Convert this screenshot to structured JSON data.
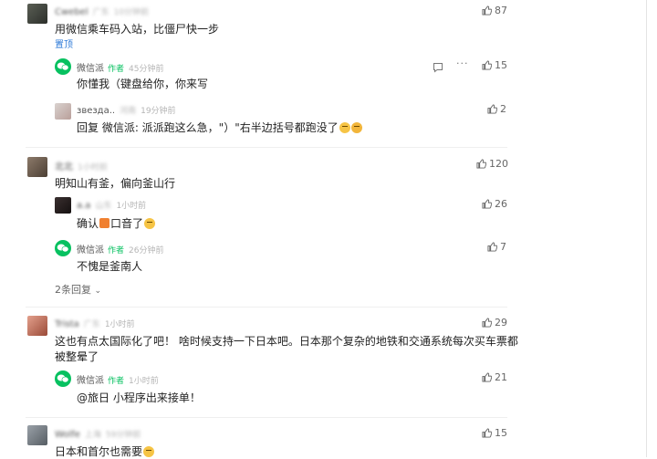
{
  "comments": [
    {
      "user": "Cwebel",
      "location": "广东",
      "time": "10分钟前",
      "text": "用微信乘车码入站，比僵尸快一步",
      "badge": "置顶",
      "likes": "87",
      "replies": [
        {
          "user": "微信派",
          "author_tag": "作者",
          "time": "45分钟前",
          "text": "你懂我（键盘给你，你来写",
          "likes": "15"
        },
        {
          "user": "звезда..",
          "location": "河南",
          "time": "19分钟前",
          "text": "回复 微信派: 派派跑这么急，\"）\"右半边括号都跑没了",
          "likes": "2"
        }
      ]
    },
    {
      "user": "北北",
      "time": "1小时前",
      "text": "明知山有釜，偏向釜山行",
      "likes": "120",
      "replies": [
        {
          "user": "a.a",
          "location": "山东",
          "time": "1小时前",
          "text_before": "确认",
          "text_after": "口音了",
          "likes": "26"
        },
        {
          "user": "微信派",
          "author_tag": "作者",
          "time": "26分钟前",
          "text": "不愧是釜南人",
          "likes": "7"
        }
      ],
      "more_replies": "2条回复"
    },
    {
      "user": "Trista",
      "location": "广东",
      "time": "1小时前",
      "text_line1": "这也有点太国际化了吧！ 啥时候支持一下日本吧。日本那个复杂的地铁和交通系统每次买车票都",
      "text_line2": "被整晕了",
      "likes": "29",
      "replies": [
        {
          "user": "微信派",
          "author_tag": "作者",
          "time": "1小时前",
          "text": "@旅日 小程序出来接单！",
          "likes": "21"
        }
      ]
    },
    {
      "user": "Wolfe",
      "location": "上海",
      "time": "59分钟前",
      "text": "日本和首尔也需要",
      "likes": "15"
    }
  ],
  "colors": {
    "wechat_green": "#07c160",
    "top_badge": "#2f7bd8"
  }
}
